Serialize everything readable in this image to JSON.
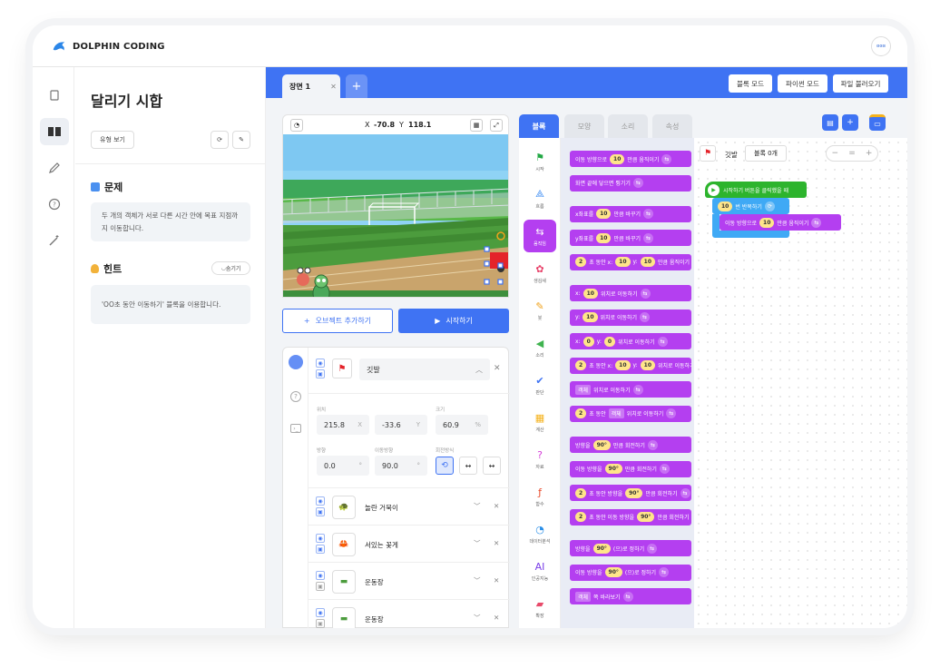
{
  "brand": {
    "name": "DOLPHIN CODING",
    "avatar_text": "ɞɞɞ"
  },
  "sidebar": {
    "items": [
      {
        "name": "book-icon"
      },
      {
        "name": "open-book-icon"
      },
      {
        "name": "pencil-icon"
      },
      {
        "name": "help-circle-icon"
      },
      {
        "name": "magic-wand-icon"
      }
    ]
  },
  "lesson": {
    "title": "달리기 시합",
    "type_button": "유형 보기",
    "problem_heading": "문제",
    "problem_text": "두 개의 객체가 서로 다른 시간 안에 목표 지점까지 이동합니다.",
    "hint_heading": "힌트",
    "hint_toggle": "숨기기",
    "hint_text": "'OO초 동안 이동하기' 블록을 이용합니다."
  },
  "scene": {
    "tab_label": "장면 1",
    "add_label": "+"
  },
  "modes": [
    "블록 모드",
    "파이썬 모드",
    "파일 불러오기"
  ],
  "stage": {
    "x_label": "X",
    "x_value": "-70.8",
    "y_label": "Y",
    "y_value": "118.1"
  },
  "actions": {
    "add_object": "오브젝트 추가하기",
    "start": "시작하기"
  },
  "selected_object": {
    "name": "깃발",
    "position_label": "위치",
    "x": "215.8",
    "x_unit": "X",
    "y": "-33.6",
    "y_unit": "Y",
    "size_label": "크기",
    "size": "60.9",
    "size_unit": "%",
    "direction_label": "방향",
    "direction": "0.0",
    "direction_unit": "°",
    "move_dir_label": "이동방향",
    "move_dir": "90.0",
    "move_dir_unit": "°",
    "rotation_label": "회전방식"
  },
  "objects": [
    {
      "name": "놀란 거북이",
      "icon": "🐢"
    },
    {
      "name": "서있는 꽃게",
      "icon": "🦀"
    },
    {
      "name": "운동장",
      "icon": "▬"
    },
    {
      "name": "운동장",
      "icon": "▬"
    }
  ],
  "code_tabs": [
    "블록",
    "모양",
    "소리",
    "속성"
  ],
  "categories": [
    {
      "label": "시작",
      "glyph": "⚑",
      "color": "#22a845"
    },
    {
      "label": "흐름",
      "glyph": "⟁",
      "color": "#3f8ef3"
    },
    {
      "label": "움직임",
      "glyph": "⇆",
      "color": "#ffffff"
    },
    {
      "label": "생김새",
      "glyph": "✿",
      "color": "#e8436b"
    },
    {
      "label": "붓",
      "glyph": "✎",
      "color": "#f0a21c"
    },
    {
      "label": "소리",
      "glyph": "◀",
      "color": "#3fb34f"
    },
    {
      "label": "판단",
      "glyph": "✔",
      "color": "#3f73f3"
    },
    {
      "label": "계산",
      "glyph": "▦",
      "color": "#f5b21c"
    },
    {
      "label": "자료",
      "glyph": "?",
      "color": "#d43fd8"
    },
    {
      "label": "함수",
      "glyph": "ƒ",
      "color": "#e84b2b"
    },
    {
      "label": "데이터분석",
      "glyph": "◔",
      "color": "#2b8fe8"
    },
    {
      "label": "인공지능",
      "glyph": "AI",
      "color": "#7a3fe8"
    },
    {
      "label": "확장",
      "glyph": "▰",
      "color": "#e84b6b"
    }
  ],
  "palette": [
    {
      "parts": [
        [
          "t",
          "이동 방향으로"
        ],
        [
          "n",
          "10"
        ],
        [
          "t",
          "만큼 움직이기"
        ]
      ]
    },
    {
      "parts": [
        [
          "t",
          "화면 끝에 닿으면 튕기기"
        ]
      ]
    },
    {
      "parts": [
        [
          "t",
          "x좌표를"
        ],
        [
          "n",
          "10"
        ],
        [
          "t",
          "만큼 바꾸기"
        ]
      ]
    },
    {
      "parts": [
        [
          "t",
          "y좌표를"
        ],
        [
          "n",
          "10"
        ],
        [
          "t",
          "만큼 바꾸기"
        ]
      ]
    },
    {
      "parts": [
        [
          "n",
          "2"
        ],
        [
          "t",
          "초 동안 x:"
        ],
        [
          "n",
          "10"
        ],
        [
          "t",
          "y:"
        ],
        [
          "n",
          "10"
        ],
        [
          "t",
          "만큼 움직이기"
        ]
      ]
    },
    {
      "parts": [
        [
          "t",
          "x:"
        ],
        [
          "n",
          "10"
        ],
        [
          "t",
          "위치로 이동하기"
        ]
      ]
    },
    {
      "parts": [
        [
          "t",
          "y:"
        ],
        [
          "n",
          "10"
        ],
        [
          "t",
          "위치로 이동하기"
        ]
      ]
    },
    {
      "parts": [
        [
          "t",
          "x:"
        ],
        [
          "n",
          "0"
        ],
        [
          "t",
          "y:"
        ],
        [
          "n",
          "0"
        ],
        [
          "t",
          "위치로 이동하기"
        ]
      ]
    },
    {
      "parts": [
        [
          "n",
          "2"
        ],
        [
          "t",
          "초 동안 x:"
        ],
        [
          "n",
          "10"
        ],
        [
          "t",
          "y:"
        ],
        [
          "n",
          "10"
        ],
        [
          "t",
          "위치로 이동하기"
        ]
      ]
    },
    {
      "parts": [
        [
          "d",
          "객체"
        ],
        [
          "t",
          "위치로 이동하기"
        ]
      ]
    },
    {
      "parts": [
        [
          "n",
          "2"
        ],
        [
          "t",
          "초 동안"
        ],
        [
          "d",
          "객체"
        ],
        [
          "t",
          "위치로 이동하기"
        ]
      ]
    },
    {
      "parts": [
        [
          "t",
          "방향을"
        ],
        [
          "n",
          "90°"
        ],
        [
          "t",
          "만큼 회전하기"
        ]
      ]
    },
    {
      "parts": [
        [
          "t",
          "이동 방향을"
        ],
        [
          "n",
          "90°"
        ],
        [
          "t",
          "만큼 회전하기"
        ]
      ]
    },
    {
      "parts": [
        [
          "n",
          "2"
        ],
        [
          "t",
          "초 동안 방향을"
        ],
        [
          "n",
          "90°"
        ],
        [
          "t",
          "만큼 회전하기"
        ]
      ]
    },
    {
      "parts": [
        [
          "n",
          "2"
        ],
        [
          "t",
          "초 동안 이동 방향을"
        ],
        [
          "n",
          "90°"
        ],
        [
          "t",
          "만큼 회전하기"
        ]
      ]
    },
    {
      "parts": [
        [
          "t",
          "방향을"
        ],
        [
          "n",
          "90°"
        ],
        [
          "t",
          "(으)로 정하기"
        ]
      ]
    },
    {
      "parts": [
        [
          "t",
          "이동 방향을"
        ],
        [
          "n",
          "90°"
        ],
        [
          "t",
          "(으)로 정하기"
        ]
      ]
    },
    {
      "parts": [
        [
          "d",
          "객체"
        ],
        [
          "t",
          "쪽 바라보기"
        ]
      ]
    }
  ],
  "workspace": {
    "object_name": "깃발",
    "block_count": "블록 0개",
    "event_block": "시작하기 버튼을 클릭했을 때",
    "repeat_count": "10",
    "repeat_label": "번 반복하기",
    "move_prefix": "이동 방향으로",
    "move_value": "10",
    "move_suffix": "만큼 움직이기"
  },
  "colors": {
    "accent": "#3f73f3",
    "motion": "#b43ff0",
    "event": "#2db42d",
    "flow": "#3fa9f5"
  }
}
